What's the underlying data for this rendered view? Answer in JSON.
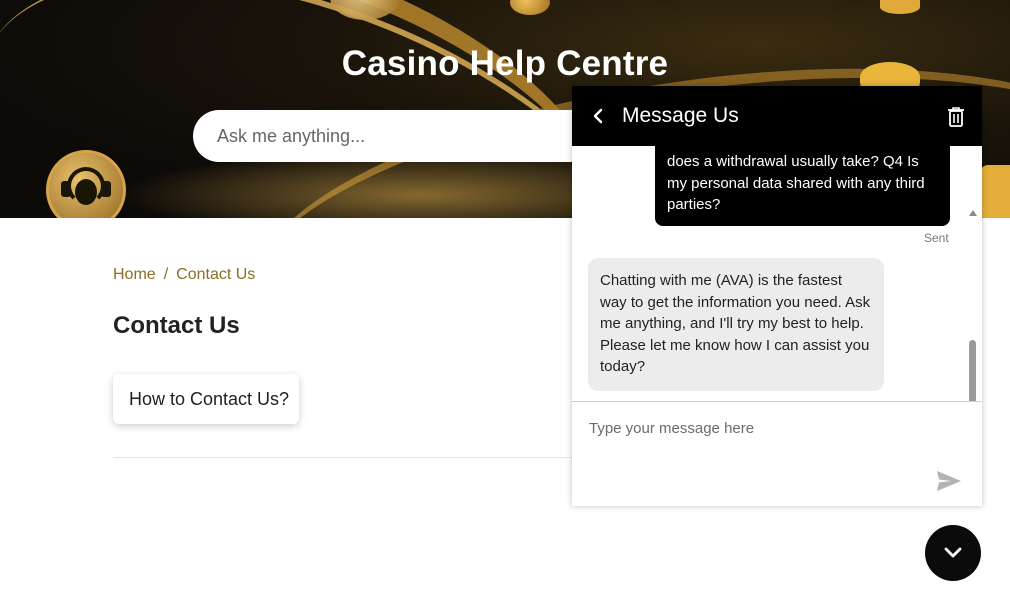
{
  "hero": {
    "title": "Casino Help Centre",
    "search_placeholder": "Ask me anything..."
  },
  "breadcrumb": {
    "home": "Home",
    "separator": "/",
    "current": "Contact Us"
  },
  "page": {
    "title": "Contact Us",
    "card_label": "How to Contact Us?"
  },
  "chat": {
    "header_title": "Message Us",
    "user_message": "does a withdrawal usually take? Q4 Is my personal data shared with any third parties?",
    "sent_label": "Sent",
    "bot_message": "Chatting with me (AVA) is the fastest way to get the information you need. Ask me anything, and I'll try my best to help. Please let me know how I can assist you today?",
    "input_placeholder": "Type your message here"
  },
  "colors": {
    "accent_gold": "#8b6f25",
    "header_bg": "#000000",
    "bot_bubble": "#ececec"
  },
  "icons": {
    "back": "chevron-left-icon",
    "trash": "trash-icon",
    "send": "send-icon",
    "collapse": "chevron-down-icon",
    "support": "headset-icon"
  }
}
